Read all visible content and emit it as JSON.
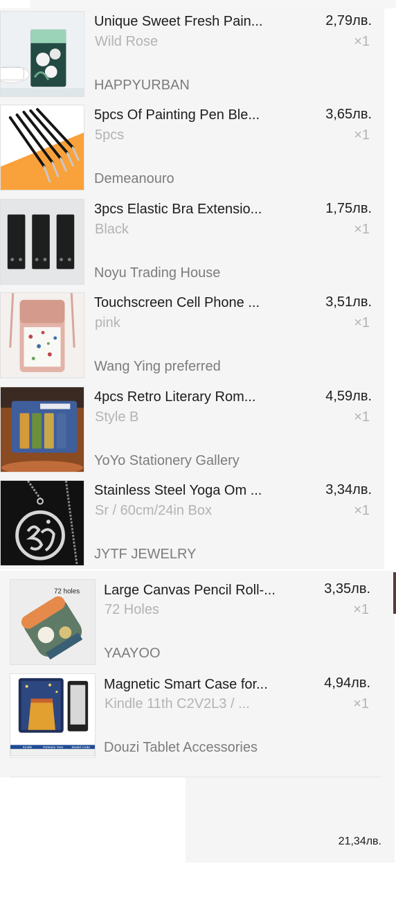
{
  "items": [
    {
      "title": "Unique Sweet Fresh Pain...",
      "variant": "Wild Rose",
      "price": "2,79лв.",
      "qty": "×1",
      "store": "HAPPYURBAN",
      "thumb_icon": "painting-kit-image"
    },
    {
      "title": "5pcs Of Painting Pen Ble...",
      "variant": "5pcs",
      "price": "3,65лв.",
      "qty": "×1",
      "store": "Demeanouro",
      "thumb_icon": "blending-pens-image"
    },
    {
      "title": "3pcs Elastic Bra Extensio...",
      "variant": "Black",
      "price": "1,75лв.",
      "qty": "×1",
      "store": "Noyu Trading House",
      "thumb_icon": "bra-extenders-image"
    },
    {
      "title": "Touchscreen Cell Phone ...",
      "variant": "pink",
      "price": "3,51лв.",
      "qty": "×1",
      "store": "Wang Ying preferred",
      "thumb_icon": "phone-bag-image"
    },
    {
      "title": "4pcs Retro Literary Rom...",
      "variant": "Style B",
      "price": "4,59лв.",
      "qty": "×1",
      "store": "YoYo Stationery Gallery",
      "thumb_icon": "bookmarks-image"
    },
    {
      "title": "Stainless Steel Yoga Om ...",
      "variant": "Sr / 60cm/24in Box",
      "price": "3,34лв.",
      "qty": "×1",
      "store": "JYTF JEWELRY",
      "thumb_icon": "om-necklace-image"
    },
    {
      "title": "Large Canvas Pencil Roll-...",
      "variant": "72 Holes",
      "price": "3,35лв.",
      "qty": "×1",
      "store": "YAAYOO",
      "thumb_icon": "pencil-roll-image",
      "thumb_caption": "72 holes"
    },
    {
      "title": "Magnetic Smart Case for...",
      "variant": "Kindle 11th C2V2L3 / ...",
      "price": "4,94лв.",
      "qty": "×1",
      "store": "Douzi Tablet Accessories",
      "thumb_icon": "kindle-case-image",
      "thumb_table": [
        "Kindle",
        "Release Year",
        "Model Code"
      ]
    }
  ],
  "total": "21,34лв.",
  "colors": {
    "panel": "#f5f5f5",
    "muted": "#b3b3b3",
    "store": "#7c7c7c"
  }
}
